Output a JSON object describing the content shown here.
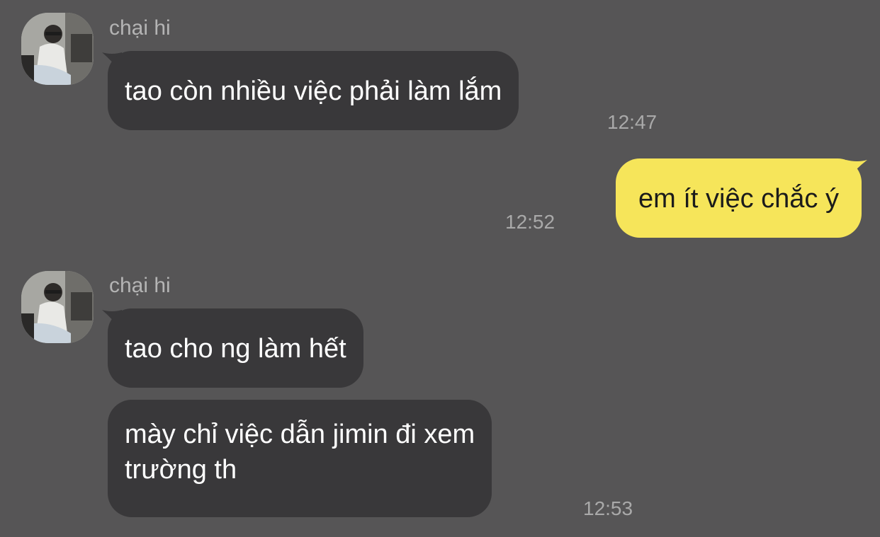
{
  "colors": {
    "background": "#565556",
    "incoming_bubble": "#39383a",
    "outgoing_bubble": "#f6e55a",
    "timestamp": "#a9a9a9",
    "sender_name": "#b4b4b4"
  },
  "messages": [
    {
      "sender": "chại hi",
      "avatar_icon": "profile-photo",
      "bubbles": [
        {
          "text": "tao còn nhiều việc phải làm lắm",
          "time": "12:47"
        }
      ]
    },
    {
      "outgoing": true,
      "bubbles": [
        {
          "text": "em ít việc chắc ý",
          "time": "12:52"
        }
      ]
    },
    {
      "sender": "chại hi",
      "avatar_icon": "profile-photo",
      "bubbles": [
        {
          "text": "tao cho ng làm hết"
        },
        {
          "text_lines": [
            "mày chỉ việc dẫn jimin đi xem",
            "trường th"
          ],
          "time": "12:53"
        }
      ]
    }
  ]
}
